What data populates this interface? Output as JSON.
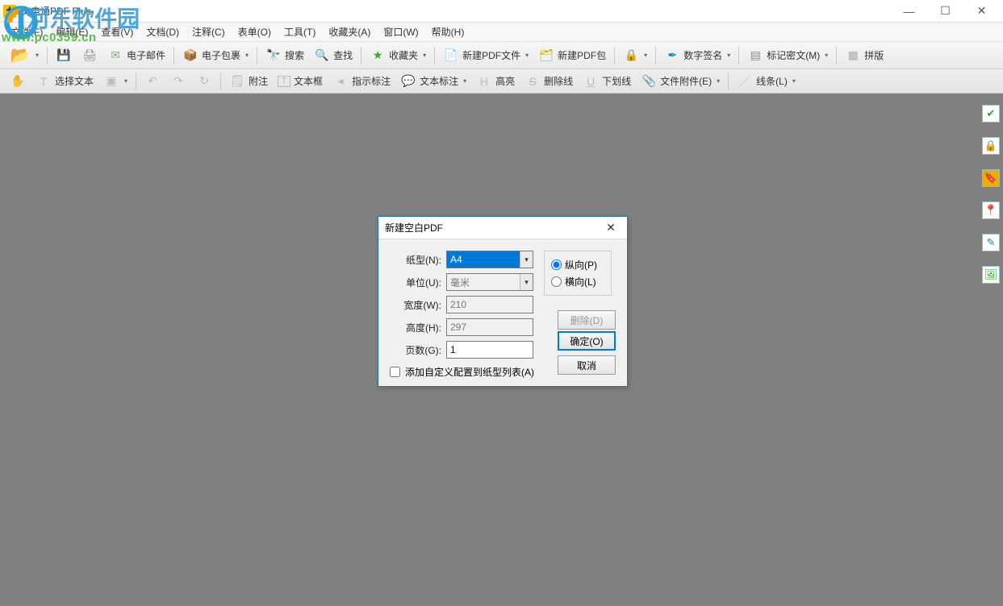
{
  "watermark": {
    "brand": "河东软件园",
    "url": "www.pc0359.cn"
  },
  "window": {
    "title": "文电通PDF Plus"
  },
  "menu": {
    "file": "文件(F)",
    "edit": "编辑(E)",
    "view": "查看(V)",
    "document": "文档(D)",
    "annotate": "注释(C)",
    "form": "表单(O)",
    "tool": "工具(T)",
    "favorite": "收藏夹(A)",
    "window": "窗口(W)",
    "help": "帮助(H)"
  },
  "toolbar1": {
    "open": "打开",
    "save": "保存",
    "print": "打印",
    "email": "电子邮件",
    "epackage": "电子包裹",
    "search": "搜索",
    "find": "查找",
    "favorite": "收藏夹",
    "newpdf_file": "新建PDF文件",
    "newpdf_pkg": "新建PDF包",
    "lock": "加密",
    "digisign": "数字签名",
    "marksecret": "标记密文(M)",
    "tile": "拼版"
  },
  "toolbar2": {
    "hand": "手形",
    "select_text": "选择文本",
    "snapshot": "快照",
    "attach": "附注",
    "textbox": "文本框",
    "pointer": "指示标注",
    "textcallout": "文本标注",
    "highlight": "高亮",
    "strike": "删除线",
    "underline": "下划线",
    "fileattach": "文件附件(E)",
    "line": "线条(L)"
  },
  "side": {
    "sign": "签名",
    "secure": "安全",
    "bookmark": "书签",
    "stamp": "图章",
    "edit": "编辑",
    "image": "图片"
  },
  "dialog": {
    "title": "新建空白PDF",
    "labels": {
      "paper": "纸型(N):",
      "unit": "单位(U):",
      "width": "宽度(W):",
      "height": "高度(H):",
      "pages": "页数(G):"
    },
    "values": {
      "paper": "A4",
      "unit": "毫米",
      "width": "210",
      "height": "297",
      "pages": "1"
    },
    "orientation": {
      "portrait": "纵向(P)",
      "landscape": "横向(L)"
    },
    "checkbox": "添加自定义配置到纸型列表(A)",
    "buttons": {
      "delete": "删除(D)",
      "ok": "确定(O)",
      "cancel": "取消"
    }
  }
}
